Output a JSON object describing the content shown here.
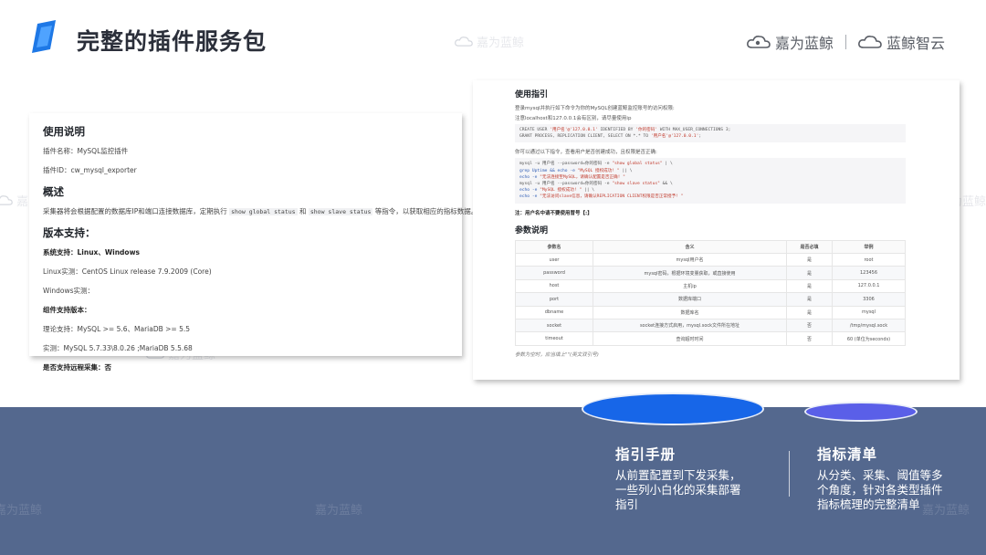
{
  "header": {
    "title": "完整的插件服务包",
    "brand_primary": "嘉为蓝鲸",
    "brand_secondary": "蓝鲸智云"
  },
  "watermark": "嘉为蓝鲸",
  "left_doc": {
    "usage_heading": "使用说明",
    "plugin_name": "插件名称：MySQL监控插件",
    "plugin_id": "插件ID：cw_mysql_exporter",
    "overview_heading": "概述",
    "overview_pre": "采集器将会根据配置的数据库IP和端口连接数据库，定期执行",
    "overview_code1": "show global status",
    "overview_mid": "和",
    "overview_code2": "show slave status",
    "overview_post": "等指令，以获取相应的指标数据。",
    "version_heading": "版本支持：",
    "system_support": "系统支持：Linux、Windows",
    "linux_tested": "Linux实测：CentOS Linux release 7.9.2009 (Core)",
    "windows_tested": "Windows实测：",
    "component_heading": "组件支持版本：",
    "theory_support": "理论支持：MySQL >= 5.6、MariaDB >= 5.5",
    "tested": "实测：MySQL 5.7.33\\8.0.26 ;MariaDB 5.5.68",
    "remote_support": "是否支持远程采集：否"
  },
  "right_doc": {
    "guide_heading": "使用指引",
    "intro_line1": "登录mysql并执行如下命令为你的MySQL创建蓝鲸监控账号的访问权限:",
    "intro_line2": "注意localhost和127.0.0.1会有区别，请尽量使用ip",
    "sql_line1_a": "CREATE USER ",
    "sql_line1_b": "'用户名'@'127.0.0.1'",
    "sql_line1_c": " IDENTIFIED BY ",
    "sql_line1_d": "'你的密码'",
    "sql_line1_e": " WITH MAX_USER_CONNECTIONS 3;",
    "sql_line2_a": "GRANT PROCESS, REPLICATION CLIENT, SELECT ON *.* TO ",
    "sql_line2_b": "'用户名'@'127.0.0.1'",
    "sql_line2_c": ";",
    "verify_line": "你可以通过以下指令，查看用户是否创建成功，且权限是否正确:",
    "cmd1_a": "mysql -u 用户名 --password=你的密码 -e ",
    "cmd1_b": "\"show global status\"",
    "cmd1_c": " | \\",
    "cmd2_a": "grep Uptime && echo -e ",
    "cmd2_b": "\"MySQL 授权成功! \"",
    "cmd2_c": " || \\",
    "cmd3_a": "echo -e ",
    "cmd3_b": "\"无法连接至MySQL，请确认配置是否正确! \"",
    "cmd4_a": "mysql -u 用户名 --password=你的密码 -e ",
    "cmd4_b": "\"show slave status\"",
    "cmd4_c": " && \\",
    "cmd5_a": "echo -e ",
    "cmd5_b": "\"MySQL 授权成功! \"",
    "cmd5_c": " || \\",
    "cmd6_a": "echo -e ",
    "cmd6_b": "\"无法访问slave信息，请确认REPLICATION CLIENT权限是否正常授予! \"",
    "note": "注：用户名中请不要使用冒号【:】",
    "params_heading": "参数说明",
    "table_headers": [
      "参数名",
      "含义",
      "是否必填",
      "举例"
    ],
    "table_rows": [
      [
        "user",
        "mysql用户名",
        "是",
        "root"
      ],
      [
        "password",
        "mysql密码，根据环境变量获取，或直接使用",
        "是",
        "123456"
      ],
      [
        "host",
        "主机ip",
        "是",
        "127.0.0.1"
      ],
      [
        "port",
        "数据库端口",
        "是",
        "3306"
      ],
      [
        "dbname",
        "数据库名",
        "是",
        "mysql"
      ],
      [
        "socket",
        "socket连接方式启用，mysql.sock文件所在地址",
        "否",
        "/tmp/mysql.sock"
      ],
      [
        "timeout",
        "查询超时时间",
        "否",
        "60 (单位为seconds)"
      ]
    ],
    "footnote": "参数为空时，应当填上\"\"(英文双引号)"
  },
  "captions": {
    "manual_title": "指引手册",
    "manual_body": [
      "从前置配置到下发采集，",
      "一些列小白化的采集部署",
      "指引"
    ],
    "metrics_title": "指标清单",
    "metrics_body": [
      "从分类、采集、阈值等多",
      "个角度，针对各类型插件",
      "指标梳理的完整清单"
    ]
  },
  "colors": {
    "band": "#54688e",
    "ellipse_primary": "#1766e8",
    "ellipse_secondary": "#5a5fe8",
    "logo_blue": "#1e78e6"
  },
  "icons": {
    "logo": "parallelogram-logo-icon",
    "brand": "cloud-icon"
  }
}
